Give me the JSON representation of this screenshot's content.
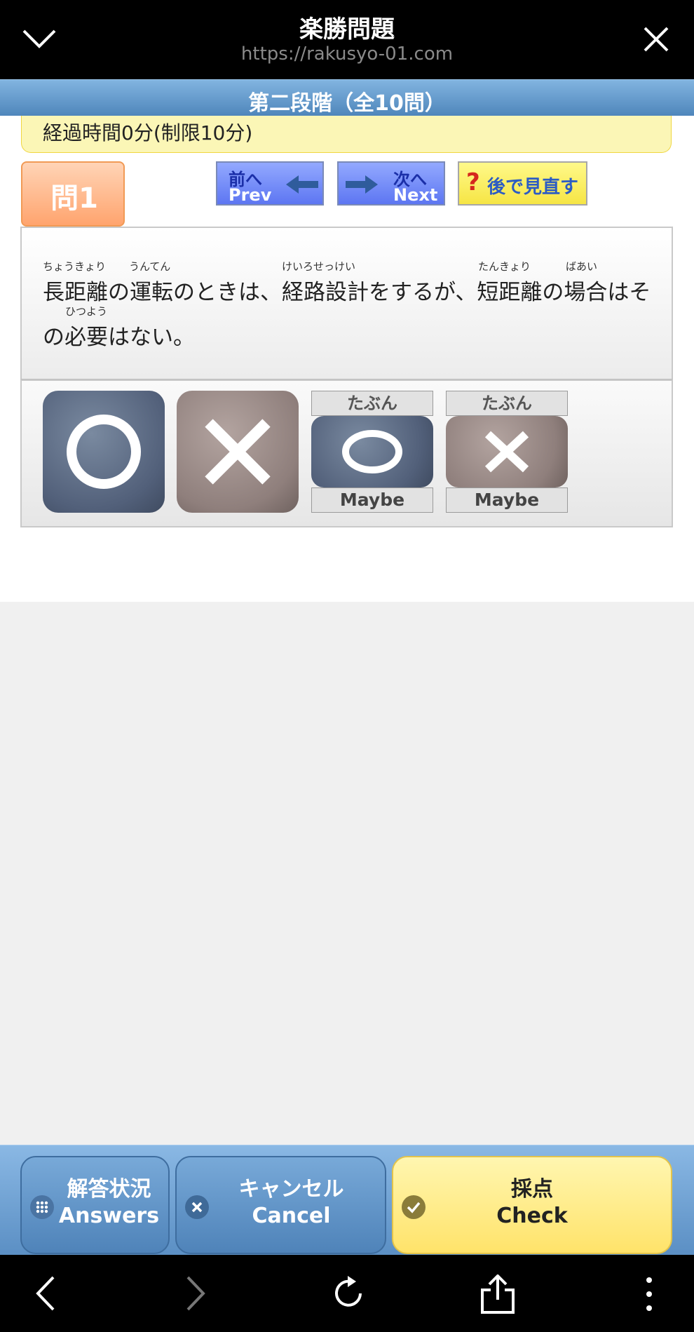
{
  "browser": {
    "title": "楽勝問題",
    "url": "https://rakusyo-01.com"
  },
  "stage": {
    "title": "第二段階（全10問）"
  },
  "timer": {
    "text": "経過時間0分(制限10分)"
  },
  "question": {
    "badge": "問1",
    "line1": "長距離の運転のときは、経路設計をするが、短距離の場合はそ",
    "line2": "の必要はない。",
    "ruby": {
      "r1": "ちょうきょり",
      "r2": "うんてん",
      "r3": "けいろせっけい",
      "r4": "たんきょり",
      "r5": "ばあい",
      "r6": "ひつよう"
    }
  },
  "nav": {
    "prev_jp": "前へ",
    "prev_en": "Prev",
    "next_jp": "次へ",
    "next_en": "Next",
    "later_mark": "?",
    "later_label": "後で見直す"
  },
  "answers": {
    "maybe_top": "たぶん",
    "maybe_bottom": "Maybe"
  },
  "actions": {
    "answers_jp": "解答状況",
    "answers_en": "Answers",
    "cancel_jp": "キャンセル",
    "cancel_en": "Cancel",
    "check_jp": "採点",
    "check_en": "Check"
  },
  "colors": {
    "stage_bar": "#5f95c9",
    "timer_bg": "#fbf6b6",
    "badge": "#ffa46e",
    "check_button": "#ffe36a"
  }
}
